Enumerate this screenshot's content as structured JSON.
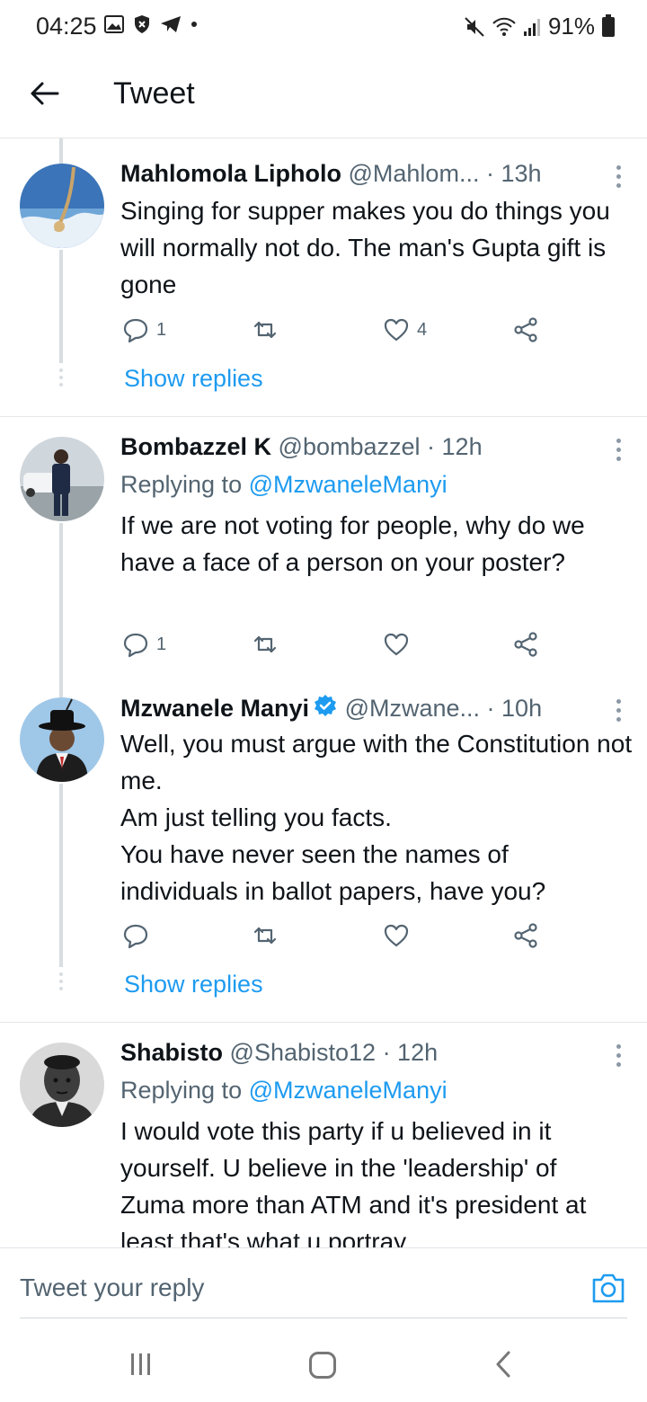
{
  "status_bar": {
    "time": "04:25",
    "battery": "91%"
  },
  "header": {
    "title": "Tweet"
  },
  "tweets": [
    {
      "name": "Mahlomola Lipholo",
      "handle": "@Mahlom...",
      "time": "· 13h",
      "text": "Singing for supper makes you do things you will normally not do. The man's Gupta gift is gone",
      "reply_count": "1",
      "like_count": "4",
      "show_replies": "Show replies"
    },
    {
      "name": "Bombazzel K",
      "handle": "@bombazzel",
      "time": "· 12h",
      "replying_prefix": "Replying to ",
      "replying_to": "@MzwaneleManyi",
      "text": "If we are not voting for people, why do we have a face of a person on your poster?",
      "reply_count": "1"
    },
    {
      "name": "Mzwanele Manyi",
      "handle": "@Mzwane...",
      "time": "· 10h",
      "text": "Well, you must argue with the Constitution not me.\nAm just telling you facts.\nYou have never seen the names of individuals in ballot papers, have you?",
      "show_replies": "Show replies"
    },
    {
      "name": "Shabisto",
      "handle": "@Shabisto12",
      "time": "· 12h",
      "replying_prefix": "Replying to ",
      "replying_to": "@MzwaneleManyi",
      "text": "I would vote this party if u believed in it yourself. U believe in the 'leadership' of Zuma more than ATM and it's president at least that's what u portray"
    }
  ],
  "composer": {
    "placeholder": "Tweet your reply"
  },
  "colors": {
    "accent": "#1d9bf0",
    "secondary_text": "#536471"
  }
}
